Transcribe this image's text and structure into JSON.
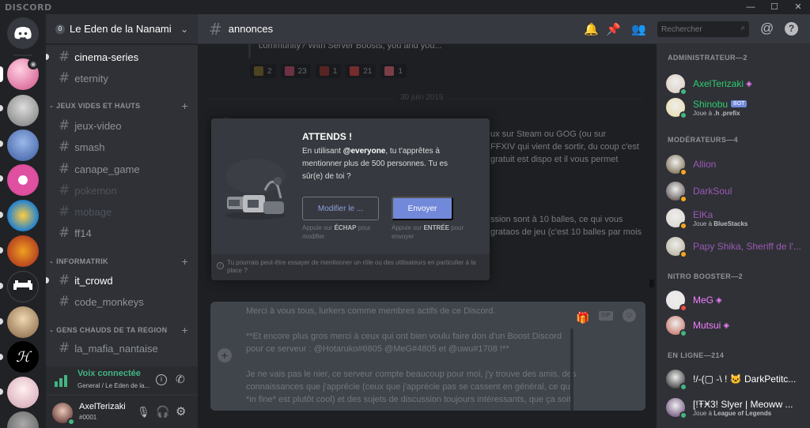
{
  "app": {
    "logo_text": "DISCORD"
  },
  "window_controls": [
    "—",
    "☐",
    "✕"
  ],
  "guild": {
    "name": "Le Eden de la Nanami",
    "boost_tier": "0"
  },
  "channels": [
    {
      "name": "cinema-series",
      "state": "unread"
    },
    {
      "name": "eternity",
      "state": "normal"
    },
    {
      "category": "JEUX VIDES ET HAUTS"
    },
    {
      "name": "jeux-video",
      "state": "normal"
    },
    {
      "name": "smash",
      "state": "normal"
    },
    {
      "name": "canape_game",
      "state": "normal"
    },
    {
      "name": "pokemon",
      "state": "muted"
    },
    {
      "name": "mobage",
      "state": "muted"
    },
    {
      "name": "ff14",
      "state": "normal"
    },
    {
      "category": "INFORMATRIK"
    },
    {
      "name": "it_crowd",
      "state": "unread"
    },
    {
      "name": "code_monkeys",
      "state": "normal"
    },
    {
      "category": "GENS CHAUDS DE TA REGION"
    },
    {
      "name": "la_mafia_nantaise",
      "state": "normal"
    }
  ],
  "voice": {
    "status": "Voix connectée",
    "location": "General / Le Eden de la..."
  },
  "user": {
    "name": "AxelTerizaki",
    "tag": "#0001"
  },
  "header": {
    "channel": "annonces",
    "search_placeholder": "Rechercher"
  },
  "messages": {
    "top_text": "community? With Server Boosts, you and you...",
    "reactions": [
      {
        "count": "2",
        "color": "#8a7a3a"
      },
      {
        "count": "23",
        "color": "#c75a7a"
      },
      {
        "count": "1",
        "color": "#a04040"
      },
      {
        "count": "21",
        "color": "#d45050"
      },
      {
        "count": "1",
        "color": "#e07080"
      }
    ],
    "date_divider": "30 juin 2019",
    "behind_lines": [
      "ux sur Steam ou GOG (ou sur",
      "FFXIV qui vient de sortir, du coup c'est",
      "gratuit est dispo et il vous permet",
      "ssion sont à 10 balles, ce qui vous",
      "grataos de jeu (c'est 10 balles par mois"
    ]
  },
  "modal": {
    "title": "ATTENDS !",
    "body_prefix": "En utilisant ",
    "body_mention": "@everyone",
    "body_suffix": ", tu t'apprêtes à mentionner plus de 500 personnes. Tu es sûr(e) de toi ?",
    "cancel_label": "Modifier le ...",
    "confirm_label": "Envoyer",
    "cancel_hint_prefix": "Appuie sur ",
    "cancel_hint_key": "ÉCHAP",
    "cancel_hint_suffix": " pour modifier",
    "confirm_hint_prefix": "Appuie sur ",
    "confirm_hint_key": "ENTRÉE",
    "confirm_hint_suffix": " pour envoyer",
    "tip": "Tu pourrais peut-être essayer de mentionner un rôle ou des utilisateurs en particulier à la place ?"
  },
  "composer": {
    "lines": [
      "Merci à vous tous, lurkers comme membres actifs de ce Discord.",
      "",
      "**Et encore plus gros merci à ceux qui ont bien voulu faire don d'un Boost Discord",
      "pour ce serveur : @Hotaruko#6805 @MeG#4805 et @uwu#1708 !**",
      "",
      "Je ne vais pas le nier, ce serveur compte beaucoup pour moi, j'y trouve des amis, des",
      "connaissances que j'apprécie (ceux que j'apprécie pas se cassent en général, ce qui",
      "*in fine* est plutôt cool) et des sujets de discussion toujours intéressants, que ça soit"
    ]
  },
  "members": {
    "sections": [
      {
        "title": "ADMINISTRATEUR—2",
        "items": [
          {
            "name": "AxelTerizaki",
            "color": "#2ecc71",
            "sub": "",
            "badge": "boost",
            "status": "#43b581",
            "avatar": "#d9c8b8"
          },
          {
            "name": "Shinobu",
            "color": "#2ecc71",
            "sub_prefix": "Joue à ",
            "sub": ".h .prefix",
            "badge": "BOT",
            "status": "#43b581",
            "avatar": "#e8d9a0"
          }
        ]
      },
      {
        "title": "MODÉRATEURS—4",
        "items": [
          {
            "name": "Allion",
            "color": "#9b59b6",
            "status": "#faa61a",
            "avatar": "#6a5a3a"
          },
          {
            "name": "DarkSoul",
            "color": "#9b59b6",
            "status": "#faa61a",
            "avatar": "#4a3a3a"
          },
          {
            "name": "ElKa",
            "color": "#9b59b6",
            "sub_prefix": "Joue à ",
            "sub": "BlueStacks",
            "status": "#faa61a",
            "avatar": "#d8d0c8"
          },
          {
            "name": "Papy Shika, Sheriff de l'...",
            "color": "#9b59b6",
            "status": "#faa61a",
            "avatar": "#b0a890"
          }
        ]
      },
      {
        "title": "NITRO BOOSTER—2",
        "items": [
          {
            "name": "MeG",
            "color": "#f47fff",
            "badge": "boost",
            "status": "#f04747",
            "avatar": "#e8e0e0"
          },
          {
            "name": "Mutsui",
            "color": "#f47fff",
            "badge": "boost",
            "status": "#43b581",
            "avatar": "#c06050"
          }
        ]
      },
      {
        "title": "EN LIGNE—214",
        "items": [
          {
            "name": "!/-(▢ -\\ ! 🐱 DarkPetitc...",
            "color": "#ffffff",
            "status": "#43b581",
            "avatar": "#1a1a1a"
          },
          {
            "name": "[!ŦӾ3! Slyer | Meoww ...",
            "color": "#ffffff",
            "sub_prefix": "Joue à ",
            "sub": "League of Legends",
            "status": "#43b581",
            "avatar": "#5a3a6a"
          }
        ]
      }
    ]
  }
}
